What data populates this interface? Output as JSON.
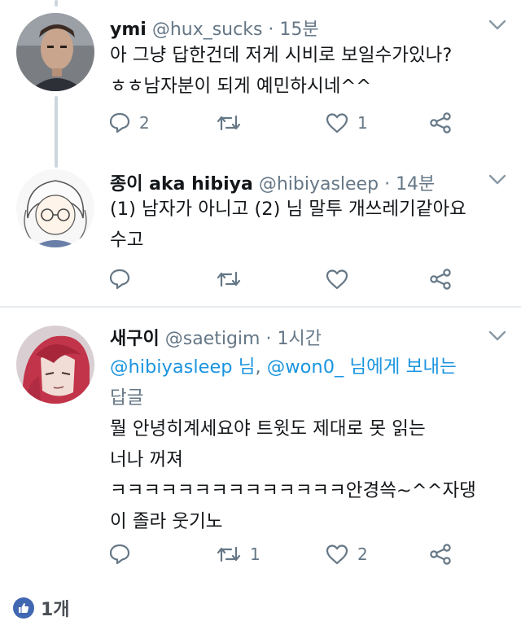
{
  "tweets": [
    {
      "name": "ymi",
      "handle": "@hux_sucks",
      "dot": "·",
      "time": "15분",
      "lines": [
        "아 그냥 답한건데 저게 시비로 보일수가있나?",
        "ㅎㅎ남자분이 되게 예민하시네^^"
      ],
      "reply_count": "2",
      "retweet_count": "",
      "like_count": "1",
      "avatar": "man-photo"
    },
    {
      "name": "종이 aka hibiya",
      "handle": "@hibiyasleep",
      "dot": "·",
      "time": "14분",
      "lines": [
        "(1) 남자가 아니고 (2) 님 말투 개쓰레기같아요",
        "수고"
      ],
      "reply_count": "",
      "retweet_count": "",
      "like_count": "",
      "avatar": "anime-girl-glasses"
    },
    {
      "name": "새구이",
      "handle": "@saetigim",
      "dot": "·",
      "time": "1시간",
      "reply_mentions": {
        "first": "@hibiyasleep 님",
        "sep": ", ",
        "second": "@won0_ 님에게 보내는",
        "tail": "답글"
      },
      "lines": [
        "뭘 안녕히계세요야 트윗도 제대로 못 읽는",
        "너나 꺼져",
        "ㅋㅋㅋㅋㅋㅋㅋㅋㅋㅋㅋㅋㅋㅋ안경쓱~^^자댕",
        "이 졸라 웃기노"
      ],
      "reply_count": "",
      "retweet_count": "1",
      "like_count": "2",
      "avatar": "anime-red-hair"
    }
  ],
  "reaction": {
    "count": "1개",
    "icon": "thumbs-up-icon",
    "color": "#4267b2"
  },
  "colors": {
    "link": "#1b95e0",
    "secondary": "#657786"
  }
}
